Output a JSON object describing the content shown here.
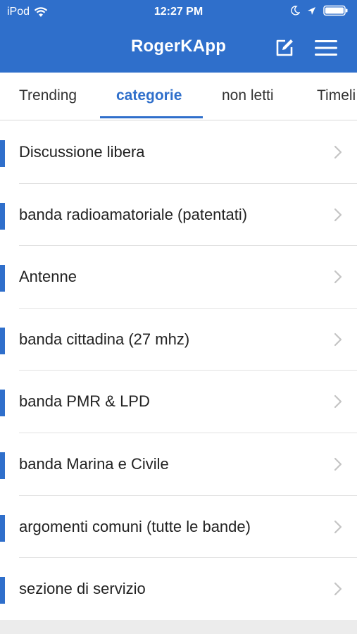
{
  "status_bar": {
    "carrier": "iPod",
    "time": "12:27 PM"
  },
  "header": {
    "title": "RogerKApp",
    "compose_icon": "compose-icon",
    "menu_icon": "hamburger-menu-icon",
    "color": "#2f6fcb"
  },
  "tabs": [
    {
      "label": "Trending",
      "active": false
    },
    {
      "label": "categorie",
      "active": true
    },
    {
      "label": "non letti",
      "active": false
    },
    {
      "label": "Timeli",
      "active": false
    }
  ],
  "categories": [
    {
      "label": "Discussione libera"
    },
    {
      "label": "banda radioamatoriale (patentati)"
    },
    {
      "label": "Antenne"
    },
    {
      "label": "banda cittadina (27 mhz)"
    },
    {
      "label": "banda PMR & LPD"
    },
    {
      "label": "banda Marina e Civile"
    },
    {
      "label": "argomenti comuni (tutte le bande)"
    },
    {
      "label": "sezione di servizio"
    }
  ]
}
